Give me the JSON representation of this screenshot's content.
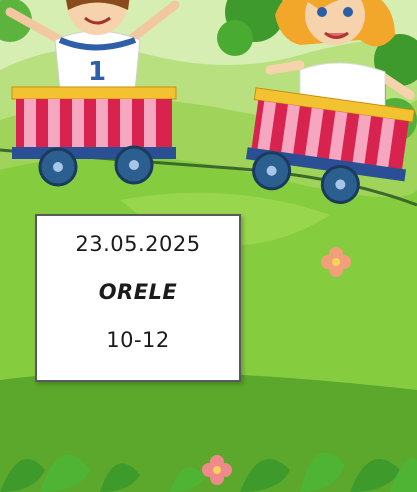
{
  "info_card": {
    "date": "23.05.2025",
    "title": "ORELE",
    "time": "10-12"
  },
  "illustration": {
    "left_child_shirt_number": "1"
  },
  "colors": {
    "sky": "#cfe9a8",
    "grass": "#7bc63a",
    "wagon_red": "#d8234e",
    "wagon_stripe": "#f6a6bf",
    "wagon_trim": "#f2c230",
    "wheels": "#2b5f8f"
  }
}
